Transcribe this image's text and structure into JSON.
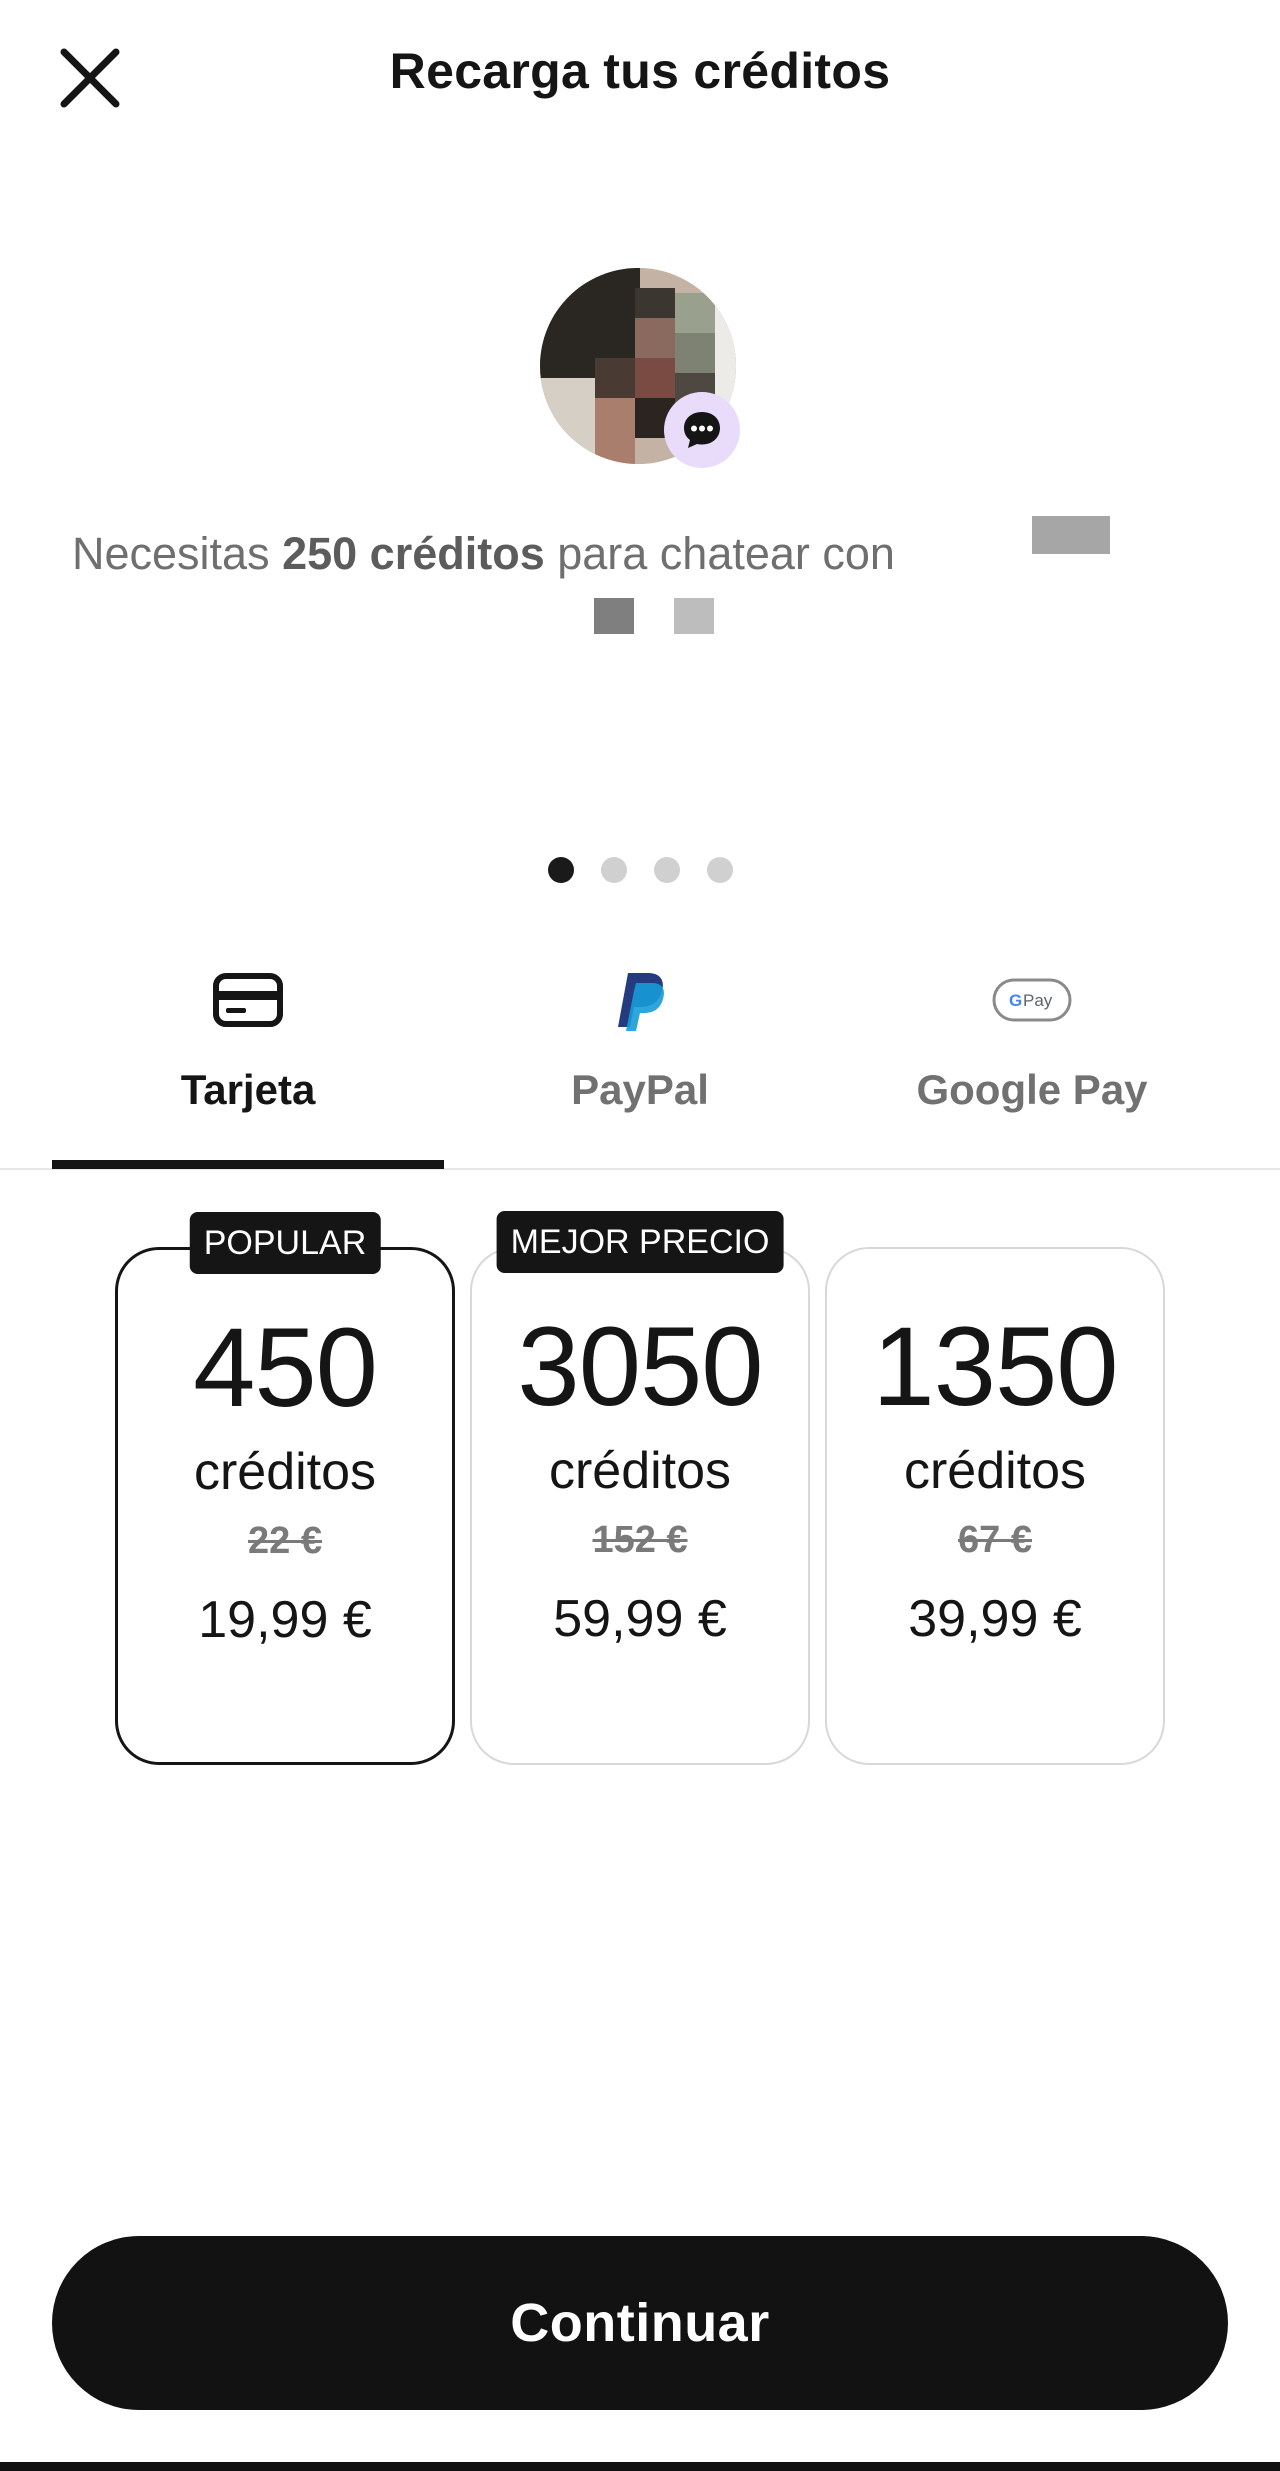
{
  "header": {
    "title": "Recarga tus créditos",
    "close_icon": "close-icon"
  },
  "message": {
    "prefix": "Necesitas ",
    "credits_bold": "250 créditos",
    "suffix": " para chatear con"
  },
  "carousel": {
    "page_count": 4,
    "active_index": 0
  },
  "payment_tabs": [
    {
      "label": "Tarjeta",
      "icon": "credit-card-icon",
      "active": true
    },
    {
      "label": "PayPal",
      "icon": "paypal-icon",
      "active": false
    },
    {
      "label": "Google Pay",
      "icon": "google-pay-icon",
      "active": false
    }
  ],
  "plans": [
    {
      "badge": "POPULAR",
      "amount": "450",
      "unit": "créditos",
      "old_price": "22 €",
      "price": "19,99 €",
      "selected": true
    },
    {
      "badge": "MEJOR PRECIO",
      "amount": "3050",
      "unit": "créditos",
      "old_price": "152 €",
      "price": "59,99 €",
      "selected": false
    },
    {
      "badge": "",
      "amount": "1350",
      "unit": "créditos",
      "old_price": "67 €",
      "price": "39,99 €",
      "selected": false
    }
  ],
  "continue_button": {
    "label": "Continuar"
  },
  "colors": {
    "primary": "#121212",
    "muted_text": "#6f6f6f",
    "badge_bg": "#e9dcfb",
    "paypal_dark": "#253b80",
    "paypal_light": "#179bd7"
  }
}
